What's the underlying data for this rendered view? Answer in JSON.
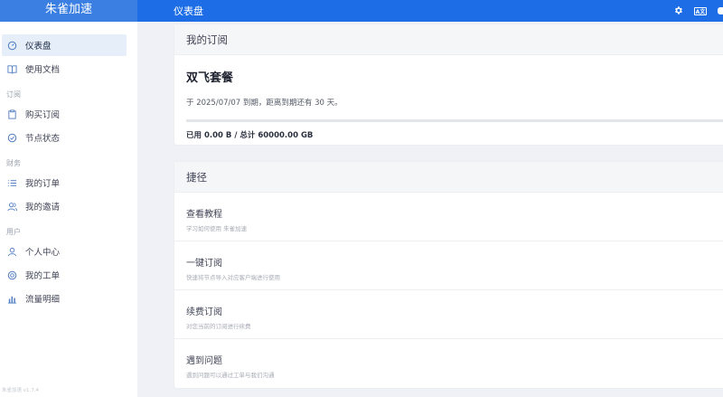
{
  "header": {
    "brand": "朱雀加速",
    "page_title": "仪表盘",
    "icons": [
      "gear-icon",
      "language-icon",
      "user-icon"
    ],
    "lang_icon_text": "A文"
  },
  "sidebar": {
    "items_top": [
      {
        "label": "仪表盘",
        "icon": "dashboard-icon",
        "active": true
      },
      {
        "label": "使用文档",
        "icon": "book-icon"
      }
    ],
    "section_subscribe": "订阅",
    "items_subscribe": [
      {
        "label": "购买订阅",
        "icon": "clipboard-icon"
      },
      {
        "label": "节点状态",
        "icon": "check-circle-icon"
      }
    ],
    "section_finance": "财务",
    "items_finance": [
      {
        "label": "我的订单",
        "icon": "list-icon"
      },
      {
        "label": "我的邀请",
        "icon": "users-icon"
      }
    ],
    "section_user": "用户",
    "items_user": [
      {
        "label": "个人中心",
        "icon": "user-icon"
      },
      {
        "label": "我的工单",
        "icon": "support-icon"
      },
      {
        "label": "流量明细",
        "icon": "bar-chart-icon"
      }
    ],
    "footer": "朱雀加速 v1.7.4"
  },
  "subscription": {
    "heading": "我的订阅",
    "plan_name": "双飞套餐",
    "expire_text": "于 2025/07/07 到期，距离到期还有 30 天。",
    "usage_fraction": 0,
    "usage_text": "已用 0.00 B / 总计 60000.00 GB"
  },
  "shortcuts": {
    "heading": "捷径",
    "items": [
      {
        "title": "查看教程",
        "desc": "学习如何使用 朱雀加速"
      },
      {
        "title": "一键订阅",
        "desc": "快速将节点导入对应客户端进行使用"
      },
      {
        "title": "续费订阅",
        "desc": "对您当前的订阅进行续费"
      },
      {
        "title": "遇到问题",
        "desc": "遇到问题可以通过工单与我们沟通"
      }
    ]
  },
  "colors": {
    "topbar": "#1d6ee6",
    "brand_bg": "#3b7fe3",
    "background": "#eff1f6",
    "active_item": "#e6eef9",
    "accent": "#4a86e0"
  }
}
